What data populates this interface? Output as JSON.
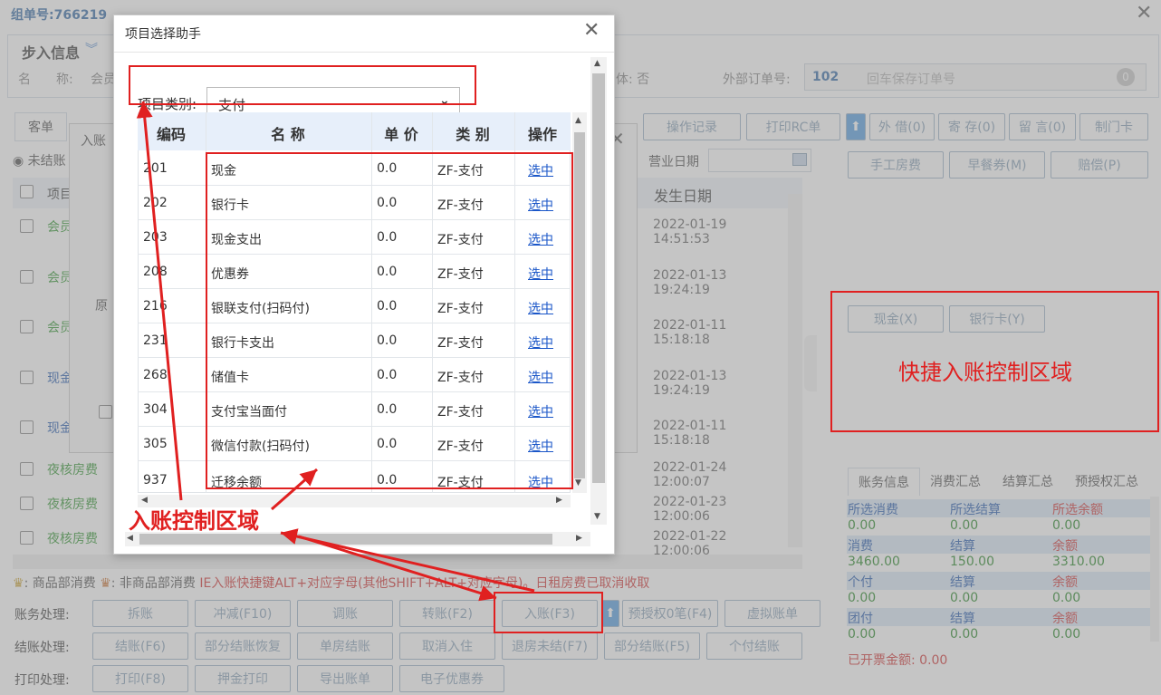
{
  "header": {
    "order_no_label": "组单号:",
    "order_no": "766219"
  },
  "guest_info": {
    "section_title": "步入信息",
    "name_label": "名　　称:",
    "name_value": "会员",
    "flag_suffix": "体: 否",
    "ext_order_label": "外部订单号:",
    "ext_order_value": "102",
    "ext_order_placeholder": "回车保存订单号",
    "ext_order_badge": "0"
  },
  "left_tabs": {
    "tab_order": "客单",
    "radio_label": "未结账",
    "col_item": "项目"
  },
  "bg_toolbar": {
    "buttons": [
      "操作记录",
      "打印RC单",
      "外 借(0)",
      "寄 存(0)",
      "留 言(0)",
      "制门卡"
    ],
    "biz_date_label": "营业日期",
    "action_buttons": [
      "手工房费",
      "早餐券(M)",
      "赔偿(P)"
    ]
  },
  "bg_rows": [
    {
      "item": "会员",
      "date": "2022-01-19 14:51:53"
    },
    {
      "item": "会员",
      "date": "2022-01-13 19:24:19"
    },
    {
      "item": "会员",
      "date": "2022-01-11 15:18:18"
    },
    {
      "item": "现金",
      "date": "2022-01-13 19:24:19"
    },
    {
      "item": "现金",
      "date": "2022-01-11 15:18:18"
    },
    {
      "item": "夜核房费",
      "date": "2022-01-24 12:00:07"
    },
    {
      "item": "夜核房费",
      "date": "2022-01-23 12:00:06"
    },
    {
      "item": "夜核房费",
      "date": "2022-01-22 12:00:06"
    }
  ],
  "bg_date_header": "发生日期",
  "quick_post": {
    "buttons": [
      "现金(X)",
      "银行卡(Y)"
    ],
    "caption": "快捷入账控制区域"
  },
  "summary": {
    "tabs": [
      "账务信息",
      "消费汇总",
      "结算汇总",
      "预授权汇总"
    ],
    "rows": [
      {
        "labels": [
          "所选消费",
          "所选结算",
          "所选余额"
        ],
        "values": [
          "0.00",
          "0.00",
          "0.00"
        ]
      },
      {
        "labels": [
          "消费",
          "结算",
          "余额"
        ],
        "values": [
          "3460.00",
          "150.00",
          "3310.00"
        ]
      },
      {
        "labels": [
          "个付",
          "结算",
          "余额"
        ],
        "values": [
          "0.00",
          "0.00",
          "0.00"
        ]
      },
      {
        "labels": [
          "团付",
          "结算",
          "余额"
        ],
        "values": [
          "0.00",
          "0.00",
          "0.00"
        ]
      }
    ],
    "invoice_label": "已开票金额: 0.00",
    "colors": {
      "label_blue": "#2a5fb0",
      "label_red": "#d23a3a",
      "value_green": "#2d8a2d"
    }
  },
  "legend": {
    "goods_text": ": 商品部消费",
    "nongoods_text": ": 非商品部消费",
    "hint": "IE入账快捷键ALT+对应字母(其他SHIFT+ALT+对应字母)。日租房费已取消收取"
  },
  "bottom": {
    "rows": [
      {
        "label": "账务处理:",
        "buttons": [
          "拆账",
          "冲减(F10)",
          "调账",
          "转账(F2)",
          "入账(F3)",
          "预授权0笔(F4)",
          "虚拟账单"
        ]
      },
      {
        "label": "结账处理:",
        "buttons": [
          "结账(F6)",
          "部分结账恢复",
          "单房结账",
          "取消入住",
          "退房未结(F7)",
          "部分结账(F5)",
          "个付结账"
        ]
      },
      {
        "label": "打印处理:",
        "buttons": [
          "打印(F8)",
          "押金打印",
          "导出账单",
          "电子优惠券"
        ]
      }
    ]
  },
  "bg_dialog": {
    "title": "入账",
    "text_original": "原"
  },
  "dialog": {
    "title": "项目选择助手",
    "category_label": "项目类别:",
    "category_value": "支付",
    "columns": [
      "编码",
      "名 称",
      "单 价",
      "类 别",
      "操作"
    ],
    "rows": [
      {
        "code": "201",
        "name": "现金",
        "price": "0.0",
        "type": "ZF-支付",
        "action": "选中"
      },
      {
        "code": "202",
        "name": "银行卡",
        "price": "0.0",
        "type": "ZF-支付",
        "action": "选中"
      },
      {
        "code": "203",
        "name": "现金支出",
        "price": "0.0",
        "type": "ZF-支付",
        "action": "选中"
      },
      {
        "code": "208",
        "name": "优惠券",
        "price": "0.0",
        "type": "ZF-支付",
        "action": "选中"
      },
      {
        "code": "216",
        "name": "银联支付(扫码付)",
        "price": "0.0",
        "type": "ZF-支付",
        "action": "选中"
      },
      {
        "code": "231",
        "name": "银行卡支出",
        "price": "0.0",
        "type": "ZF-支付",
        "action": "选中"
      },
      {
        "code": "268",
        "name": "储值卡",
        "price": "0.0",
        "type": "ZF-支付",
        "action": "选中"
      },
      {
        "code": "304",
        "name": "支付宝当面付",
        "price": "0.0",
        "type": "ZF-支付",
        "action": "选中"
      },
      {
        "code": "305",
        "name": "微信付款(扫码付)",
        "price": "0.0",
        "type": "ZF-支付",
        "action": "选中"
      },
      {
        "code": "937",
        "name": "迁移余额",
        "price": "0.0",
        "type": "ZF-支付",
        "action": "选中"
      }
    ]
  },
  "annotation": {
    "caption": "入账控制区域",
    "color": "#e02020"
  }
}
